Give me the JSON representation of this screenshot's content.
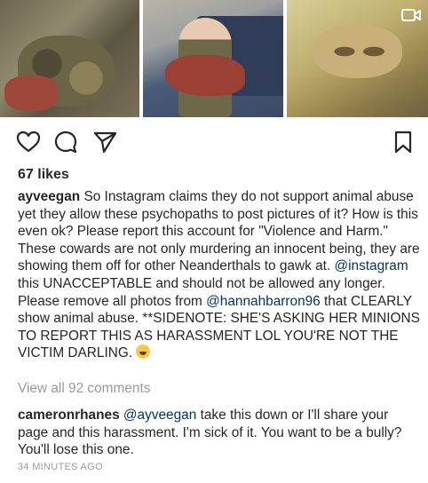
{
  "post": {
    "media": {
      "images": [
        "camo-hunter-with-meat",
        "hunter-with-truck-holding-meat",
        "camo-face-closeup"
      ],
      "video_indicator_icon": "video-camera-icon"
    },
    "actions": {
      "like_icon": "heart-icon",
      "comment_icon": "comment-bubble-icon",
      "share_icon": "paper-plane-icon",
      "save_icon": "bookmark-icon"
    },
    "likes": "67 likes",
    "caption": {
      "username": "ayveegan",
      "text_1": "So Instagram claims they do not support animal abuse yet they allow these psychopaths to post pictures of it? How is this even ok? Please report this account for \"Violence and Harm.\" These cowards are not only murdering an innocent being, they are showing them off for other Neanderthals to gawk at.",
      "mention_1": "@instagram",
      "text_2": "this UNACCEPTABLE and should not be allowed any longer. Please remove all photos from",
      "mention_2": "@hannahbarron96",
      "text_3": "that CLEARLY show animal abuse. **SIDENOTE: SHE'S ASKING HER MINIONS TO REPORT THIS AS HARASSMENT LOL YOU'RE NOT THE VICTIM DARLING.",
      "emoji": "laughing-emoji"
    },
    "view_all_comments": "View all 92 comments",
    "comment": {
      "username": "cameronrhanes",
      "mention": "@ayveegan",
      "text": "take this down or I'll share your page and this harassment. I'm sick of it. You want to be a bully? You'll lose this one."
    },
    "timestamp": "34 MINUTES AGO"
  }
}
